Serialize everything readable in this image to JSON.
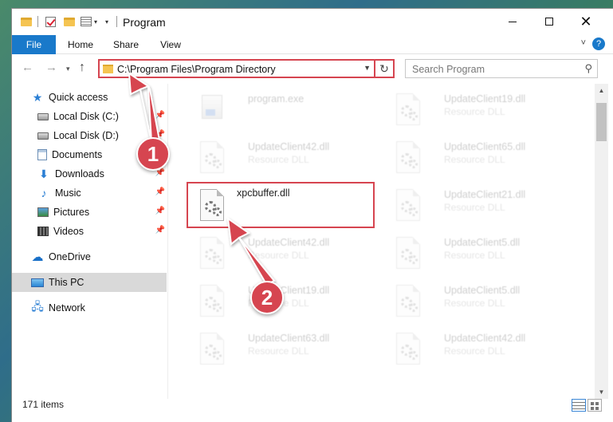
{
  "window": {
    "title": "Program",
    "controls": {
      "minimize": "",
      "maximize": "",
      "close": "✕"
    }
  },
  "ribbon": {
    "tabs": [
      "File",
      "Home",
      "Share",
      "View"
    ],
    "help": "?"
  },
  "address_bar": {
    "path": "C:\\Program Files\\Program Directory",
    "refresh": "↻",
    "dropdown": "▼"
  },
  "search": {
    "placeholder": "Search Program"
  },
  "sidebar": {
    "items": [
      {
        "label": "Quick access",
        "icon": "star-icon"
      },
      {
        "label": "Local Disk (C:)",
        "icon": "drive-icon",
        "pinned": true
      },
      {
        "label": "Local Disk (D:)",
        "icon": "drive-icon",
        "pinned": true
      },
      {
        "label": "Documents",
        "icon": "documents-icon",
        "pinned": true
      },
      {
        "label": "Downloads",
        "icon": "download-icon",
        "pinned": true
      },
      {
        "label": "Music",
        "icon": "music-icon",
        "pinned": true
      },
      {
        "label": "Pictures",
        "icon": "pictures-icon",
        "pinned": true
      },
      {
        "label": "Videos",
        "icon": "videos-icon",
        "pinned": true
      },
      {
        "label": "OneDrive",
        "icon": "cloud-icon"
      },
      {
        "label": "This PC",
        "icon": "computer-icon",
        "selected": true
      },
      {
        "label": "Network",
        "icon": "network-icon"
      }
    ]
  },
  "files": [
    {
      "name": "program.exe",
      "type": "",
      "icon": "exe-icon",
      "faded": true
    },
    {
      "name": "UpdateClient19.dll",
      "type": "Resource DLL",
      "icon": "dll-icon",
      "faded": true
    },
    {
      "name": "UpdateClient42.dll",
      "type": "Resource DLL",
      "icon": "dll-icon",
      "faded": true
    },
    {
      "name": "UpdateClient65.dll",
      "type": "Resource DLL",
      "icon": "dll-icon",
      "faded": true
    },
    {
      "name": "xpcbuffer.dll",
      "type": "",
      "icon": "dll-icon",
      "faded": false
    },
    {
      "name": "UpdateClient21.dll",
      "type": "Resource DLL",
      "icon": "dll-icon",
      "faded": true
    },
    {
      "name": "UpdateClient42.dll",
      "type": "Resource DLL",
      "icon": "dll-icon",
      "faded": true
    },
    {
      "name": "UpdateClient5.dll",
      "type": "Resource DLL",
      "icon": "dll-icon",
      "faded": true
    },
    {
      "name": "UpdateClient19.dll",
      "type": "Resource DLL",
      "icon": "dll-icon",
      "faded": true
    },
    {
      "name": "UpdateClient5.dll",
      "type": "Resource DLL",
      "icon": "dll-icon",
      "faded": true
    },
    {
      "name": "UpdateClient63.dll",
      "type": "Resource DLL",
      "icon": "dll-icon",
      "faded": true
    },
    {
      "name": "UpdateClient42.dll",
      "type": "Resource DLL",
      "icon": "dll-icon",
      "faded": true
    }
  ],
  "status": {
    "item_count": "171 items"
  },
  "annotations": {
    "step1": "1",
    "step2": "2",
    "color": "#d64550"
  }
}
